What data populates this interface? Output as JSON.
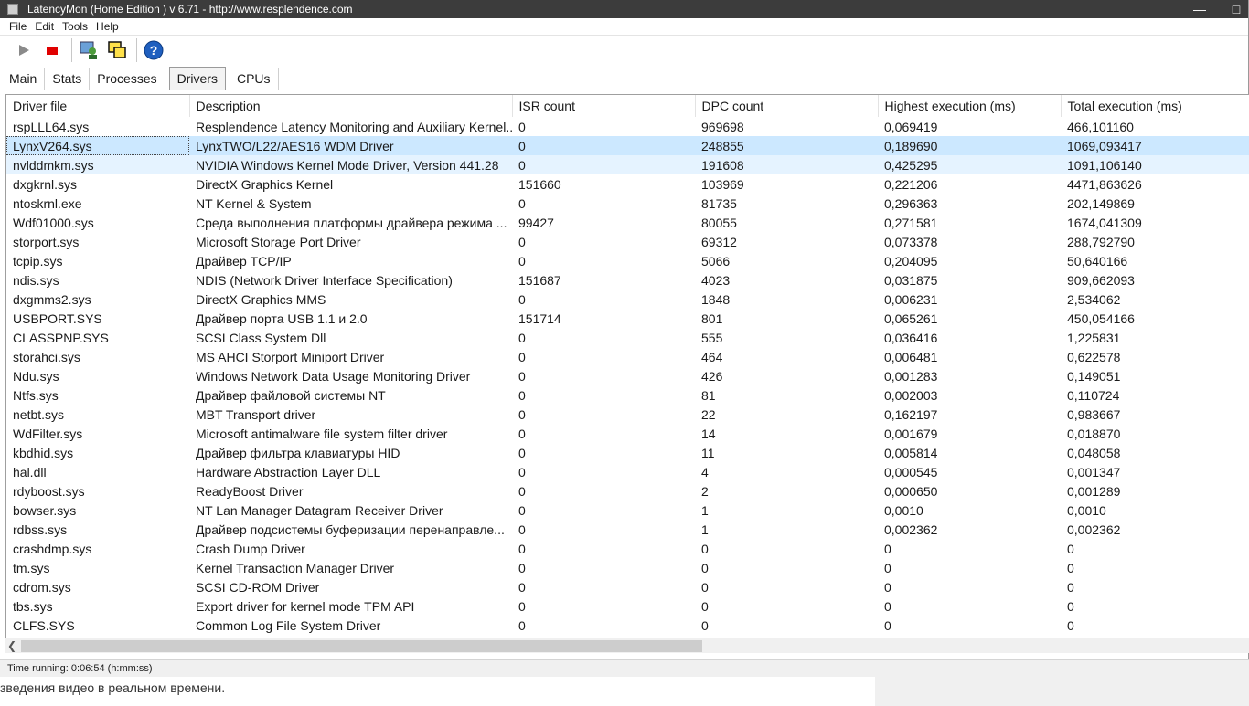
{
  "window": {
    "title": "LatencyMon  (Home Edition )  v 6.71 - http://www.resplendence.com"
  },
  "menu": [
    "File",
    "Edit",
    "Tools",
    "Help"
  ],
  "toolbar": {
    "buttons": [
      "play-icon",
      "stop-icon",
      "network-user-icon",
      "windows-icon",
      "help-icon"
    ]
  },
  "tabs": [
    "Main",
    "Stats",
    "Processes",
    "Drivers",
    "CPUs"
  ],
  "active_tab": "Drivers",
  "table": {
    "headers": [
      "Driver file",
      "Description",
      "ISR count",
      "DPC count",
      "Highest execution (ms)",
      "Total execution (ms)"
    ],
    "rows": [
      [
        "rspLLL64.sys",
        "Resplendence Latency Monitoring and Auxiliary Kernel...",
        "0",
        "969698",
        "0,069419",
        "466,101160"
      ],
      [
        "LynxV264.sys",
        "LynxTWO/L22/AES16 WDM Driver",
        "0",
        "248855",
        "0,189690",
        "1069,093417"
      ],
      [
        "nvlddmkm.sys",
        "NVIDIA Windows Kernel Mode Driver, Version 441.28",
        "0",
        "191608",
        "0,425295",
        "1091,106140"
      ],
      [
        "dxgkrnl.sys",
        "DirectX Graphics Kernel",
        "151660",
        "103969",
        "0,221206",
        "4471,863626"
      ],
      [
        "ntoskrnl.exe",
        "NT Kernel & System",
        "0",
        "81735",
        "0,296363",
        "202,149869"
      ],
      [
        "Wdf01000.sys",
        "Среда выполнения платформы драйвера режима ...",
        "99427",
        "80055",
        "0,271581",
        "1674,041309"
      ],
      [
        "storport.sys",
        "Microsoft Storage Port Driver",
        "0",
        "69312",
        "0,073378",
        "288,792790"
      ],
      [
        "tcpip.sys",
        "Драйвер TCP/IP",
        "0",
        "5066",
        "0,204095",
        "50,640166"
      ],
      [
        "ndis.sys",
        "NDIS (Network Driver Interface Specification)",
        "151687",
        "4023",
        "0,031875",
        "909,662093"
      ],
      [
        "dxgmms2.sys",
        "DirectX Graphics MMS",
        "0",
        "1848",
        "0,006231",
        "2,534062"
      ],
      [
        "USBPORT.SYS",
        "Драйвер порта USB 1.1 и 2.0",
        "151714",
        "801",
        "0,065261",
        "450,054166"
      ],
      [
        "CLASSPNP.SYS",
        "SCSI Class System Dll",
        "0",
        "555",
        "0,036416",
        "1,225831"
      ],
      [
        "storahci.sys",
        "MS AHCI Storport Miniport Driver",
        "0",
        "464",
        "0,006481",
        "0,622578"
      ],
      [
        "Ndu.sys",
        "Windows Network Data Usage Monitoring Driver",
        "0",
        "426",
        "0,001283",
        "0,149051"
      ],
      [
        "Ntfs.sys",
        "Драйвер файловой системы NT",
        "0",
        "81",
        "0,002003",
        "0,110724"
      ],
      [
        "netbt.sys",
        "MBT Transport driver",
        "0",
        "22",
        "0,162197",
        "0,983667"
      ],
      [
        "WdFilter.sys",
        "Microsoft antimalware file system filter driver",
        "0",
        "14",
        "0,001679",
        "0,018870"
      ],
      [
        "kbdhid.sys",
        "Драйвер фильтра клавиатуры HID",
        "0",
        "11",
        "0,005814",
        "0,048058"
      ],
      [
        "hal.dll",
        "Hardware Abstraction Layer DLL",
        "0",
        "4",
        "0,000545",
        "0,001347"
      ],
      [
        "rdyboost.sys",
        "ReadyBoost Driver",
        "0",
        "2",
        "0,000650",
        "0,001289"
      ],
      [
        "bowser.sys",
        "NT Lan Manager Datagram Receiver Driver",
        "0",
        "1",
        "0,0010",
        "0,0010"
      ],
      [
        "rdbss.sys",
        "Драйвер подсистемы буферизации перенаправле...",
        "0",
        "1",
        "0,002362",
        "0,002362"
      ],
      [
        "crashdmp.sys",
        "Crash Dump Driver",
        "0",
        "0",
        "0",
        "0"
      ],
      [
        "tm.sys",
        "Kernel Transaction Manager Driver",
        "0",
        "0",
        "0",
        "0"
      ],
      [
        "cdrom.sys",
        "SCSI CD-ROM Driver",
        "0",
        "0",
        "0",
        "0"
      ],
      [
        "tbs.sys",
        "Export driver for kernel mode TPM API",
        "0",
        "0",
        "0",
        "0"
      ],
      [
        "CLFS.SYS",
        "Common Log File System Driver",
        "0",
        "0",
        "0",
        "0"
      ]
    ],
    "selected_row": 1,
    "hover_row": 2
  },
  "status": {
    "text": "Time running: 0:06:54  (h:mm:ss)"
  },
  "background_text": "зведения видео в реальном времени.",
  "colors": {
    "titlebar": "#3c3c3c",
    "selection": "#cce8ff",
    "hover": "#e5f3ff",
    "stop": "#e00000",
    "help": "#1f5fbf"
  }
}
